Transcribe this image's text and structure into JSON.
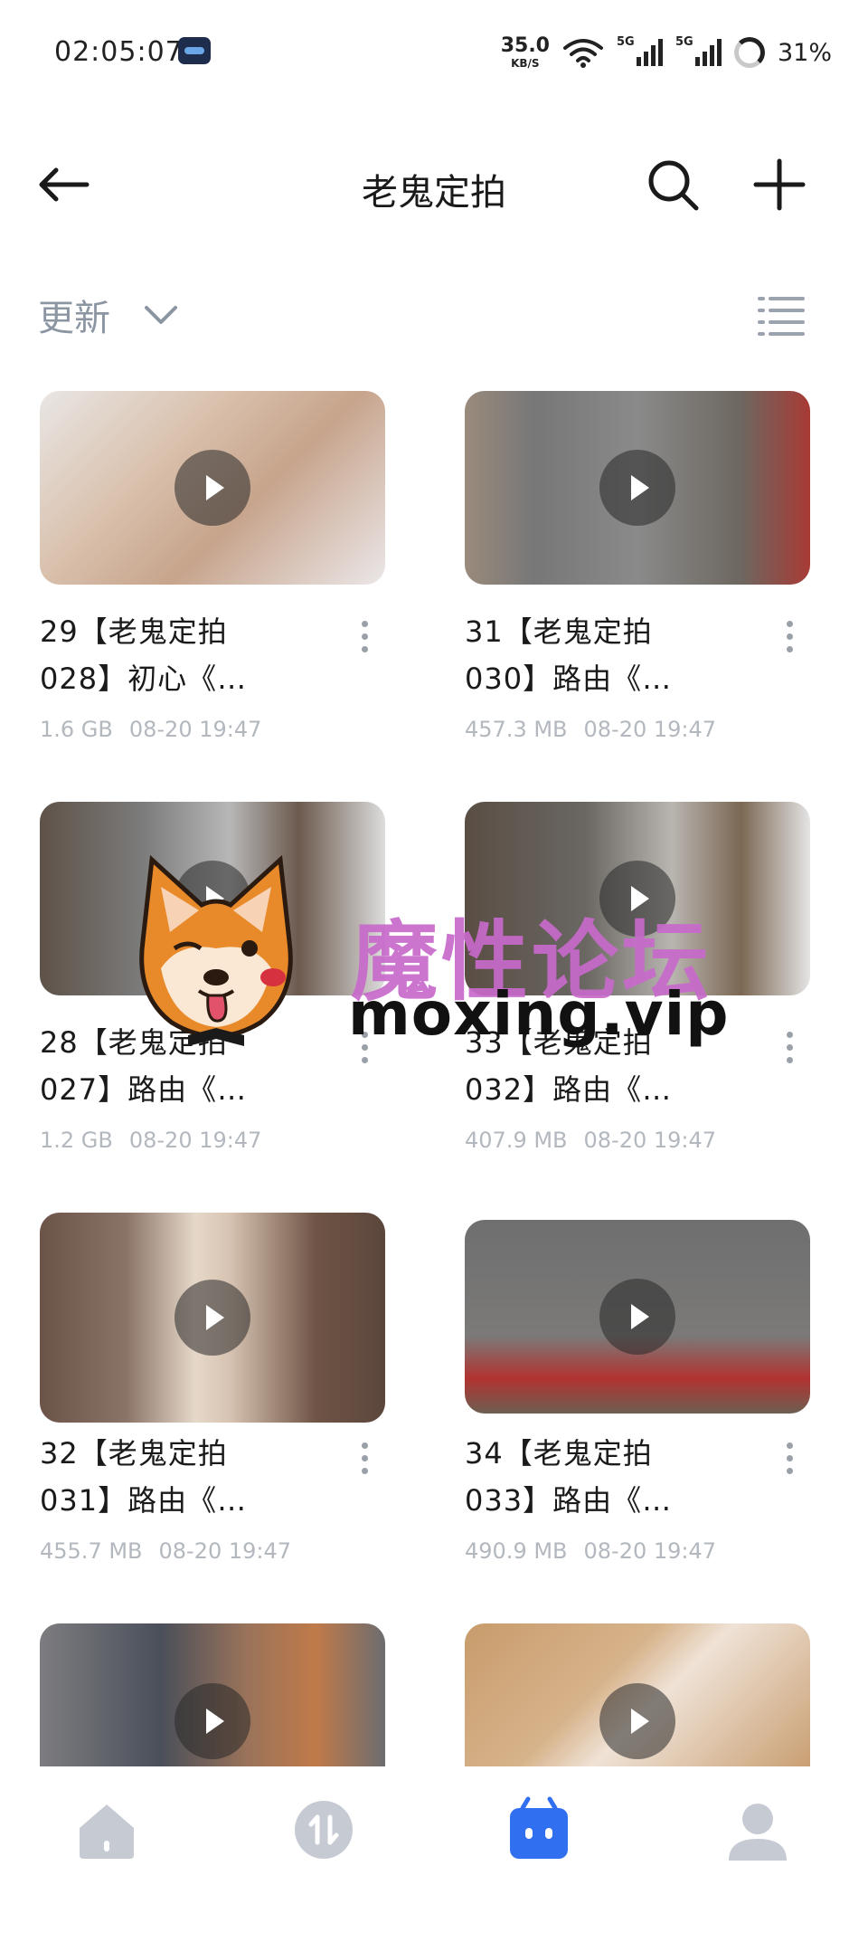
{
  "status_bar": {
    "time": "02:05:07",
    "net_speed_value": "35.0",
    "net_speed_unit": "KB/S",
    "sim1_label": "5G",
    "sim2_label": "5G",
    "battery": "31%"
  },
  "header": {
    "title": "老鬼定拍",
    "back_icon": "back-arrow-icon",
    "search_icon": "search-icon",
    "add_icon": "plus-icon"
  },
  "sort": {
    "label": "更新",
    "list_icon": "list-view-icon"
  },
  "files": [
    {
      "title_line1": "29【老鬼定拍",
      "title_line2": "028】初心《…",
      "size": "1.6 GB",
      "date": "08-20 19:47"
    },
    {
      "title_line1": "31【老鬼定拍",
      "title_line2": "030】路由《…",
      "size": "457.3 MB",
      "date": "08-20 19:47"
    },
    {
      "title_line1": "28【老鬼定拍",
      "title_line2": "027】路由《…",
      "size": "1.2 GB",
      "date": "08-20 19:47"
    },
    {
      "title_line1": "33【老鬼定拍",
      "title_line2": "032】路由《…",
      "size": "407.9 MB",
      "date": "08-20 19:47"
    },
    {
      "title_line1": "32【老鬼定拍",
      "title_line2": "031】路由《…",
      "size": "455.7 MB",
      "date": "08-20 19:47"
    },
    {
      "title_line1": "34【老鬼定拍",
      "title_line2": "033】路由《…",
      "size": "490.9 MB",
      "date": "08-20 19:47"
    }
  ],
  "watermark": {
    "cn": "魔性论坛",
    "en": "moxing.vip"
  },
  "bottom_nav": [
    {
      "name": "home",
      "icon": "home-icon",
      "active": false
    },
    {
      "name": "transfer",
      "icon": "transfer-icon",
      "active": false
    },
    {
      "name": "files",
      "icon": "cloud-drive-icon",
      "active": true
    },
    {
      "name": "profile",
      "icon": "profile-icon",
      "active": false
    }
  ],
  "colors": {
    "accent": "#2f6ff0",
    "nav_inactive": "#c5cad3",
    "meta_text": "#b3b8bf"
  }
}
